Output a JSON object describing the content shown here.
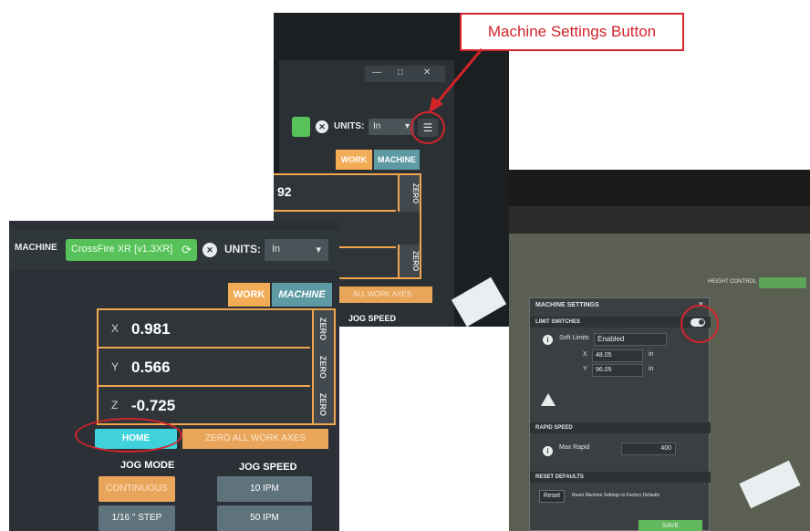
{
  "callout": {
    "label": "Machine Settings Button"
  },
  "top_photo": {
    "units_label": "UNITS:",
    "units_value": "In",
    "tabs": {
      "work": "WORK",
      "machine": "MACHINE"
    },
    "partial_value": "92",
    "zero_label": "ZERO",
    "zero_all": "ALL WORK AXES",
    "jog_speed": "JOG SPEED"
  },
  "left_photo": {
    "machine_label": "MACHINE",
    "machine_name": "CrossFire XR  [v1.3XR]",
    "units_label": "UNITS:",
    "units_value": "In",
    "tabs": {
      "work": "WORK",
      "machine": "MACHINE"
    },
    "axes": [
      {
        "axis": "X",
        "value": "0.981",
        "zero": "ZERO"
      },
      {
        "axis": "Y",
        "value": "0.566",
        "zero": "ZERO"
      },
      {
        "axis": "Z",
        "value": "-0.725",
        "zero": "ZERO"
      }
    ],
    "home_label": "HOME",
    "zero_all_label": "ZERO ALL WORK AXES",
    "jog_mode_label": "JOG MODE",
    "jog_speed_label": "JOG SPEED",
    "jog_mode_options": [
      "CONTINUOUS",
      "1/16 \" STEP"
    ],
    "jog_speed_options": [
      "10 IPM",
      "50 IPM"
    ]
  },
  "right_photo": {
    "header_right": "HEIGHT CONTROL",
    "dialog_title": "MACHINE SETTINGS",
    "limit_switches": "LIMIT SWITCHES",
    "soft_limits_label": "Soft Limits",
    "soft_limits_value": "Enabled",
    "x_label": "X",
    "x_value": "48.05",
    "y_label": "Y",
    "y_value": "96.05",
    "unit": "in",
    "rapid_speed": "RAPID SPEED",
    "max_rapid": "Max Rapid",
    "max_rapid_value": "400",
    "reset_defaults": "RESET DEFAULTS",
    "reset_button": "Reset",
    "reset_text": "Reset Machine Settings to Factory Defaults",
    "save": "SAVE"
  }
}
